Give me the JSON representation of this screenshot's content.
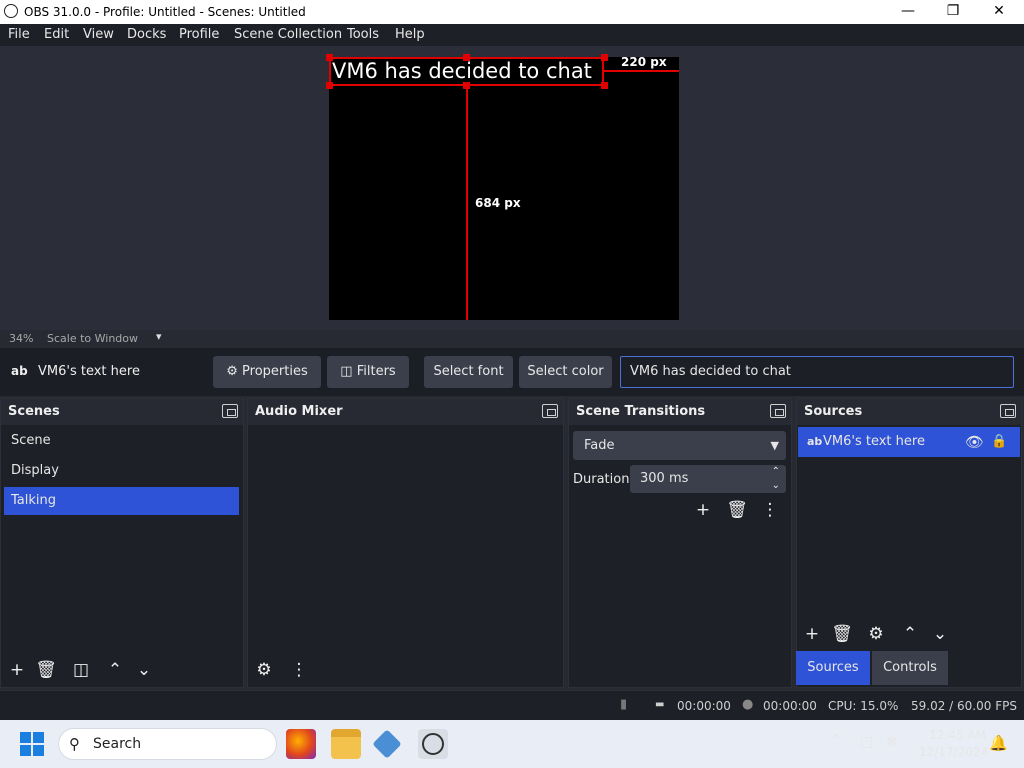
{
  "window": {
    "title": "OBS 31.0.0 - Profile: Untitled - Scenes: Untitled",
    "min": "—",
    "max": "❐",
    "close": "✕"
  },
  "menu": [
    "File",
    "Edit",
    "View",
    "Docks",
    "Profile",
    "Scene Collection",
    "Tools",
    "Help"
  ],
  "preview": {
    "text_source": "VM6 has decided to chat",
    "dim_h": "220 px",
    "dim_v": "684 px"
  },
  "zoom": {
    "percent": "34%",
    "mode": "Scale to Window"
  },
  "toolbar": {
    "source_label": "VM6's text here",
    "source_icon": "ab",
    "properties": "Properties",
    "filters": "Filters",
    "select_font": "Select font",
    "select_color": "Select color",
    "text_value": "VM6 has decided to chat"
  },
  "scenes": {
    "title": "Scenes",
    "items": [
      "Scene",
      "Display",
      "Talking"
    ],
    "selected": 2
  },
  "audio_mixer": {
    "title": "Audio Mixer"
  },
  "transitions": {
    "title": "Scene Transitions",
    "selected": "Fade",
    "duration_label": "Duration",
    "duration_value": "300 ms"
  },
  "sources": {
    "title": "Sources",
    "item_icon": "ab",
    "item_label": "VM6's text here",
    "tab_sources": "Sources",
    "tab_controls": "Controls"
  },
  "status": {
    "rec_time": "00:00:00",
    "stream_time": "00:00:00",
    "cpu": "CPU: 15.0%",
    "fps": "59.02 / 60.00 FPS"
  },
  "taskbar": {
    "search": "Search",
    "time": "12:45 AM",
    "date": "12/17/2024"
  },
  "colors": {
    "accent": "#2f53d6",
    "selection_red": "#e00000"
  }
}
